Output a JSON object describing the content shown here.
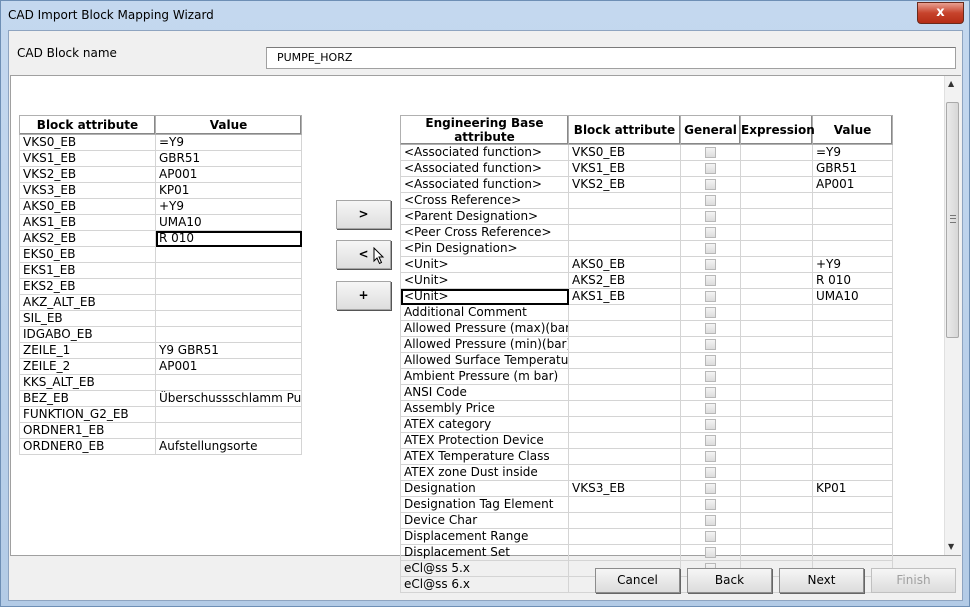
{
  "window": {
    "title": "CAD Import Block Mapping Wizard",
    "close": "x"
  },
  "block_name": {
    "label": "CAD Block name",
    "value": "PUMPE_HORZ"
  },
  "left_table": {
    "headers": [
      "Block attribute",
      "Value"
    ],
    "rows": [
      [
        "VKS0_EB",
        "=Y9"
      ],
      [
        "VKS1_EB",
        "GBR51"
      ],
      [
        "VKS2_EB",
        "AP001"
      ],
      [
        "VKS3_EB",
        "KP01"
      ],
      [
        "AKS0_EB",
        "+Y9"
      ],
      [
        "AKS1_EB",
        "UMA10"
      ],
      [
        "AKS2_EB",
        "R 010"
      ],
      [
        "EKS0_EB",
        ""
      ],
      [
        "EKS1_EB",
        ""
      ],
      [
        "EKS2_EB",
        ""
      ],
      [
        "AKZ_ALT_EB",
        ""
      ],
      [
        "SIL_EB",
        ""
      ],
      [
        "IDGABO_EB",
        ""
      ],
      [
        "ZEILE_1",
        "Y9 GBR51"
      ],
      [
        "ZEILE_2",
        "AP001"
      ],
      [
        "KKS_ALT_EB",
        ""
      ],
      [
        "BEZ_EB",
        "Überschussschlamm Pu"
      ],
      [
        "FUNKTION_G2_EB",
        ""
      ],
      [
        "ORDNER1_EB",
        ""
      ],
      [
        "ORDNER0_EB",
        "Aufstellungsorte"
      ]
    ]
  },
  "middle_buttons": {
    "assign": ">",
    "remove": "<",
    "add": "+"
  },
  "right_table": {
    "headers": [
      "Engineering Base attribute",
      "Block attribute",
      "General",
      "Expression",
      "Value"
    ],
    "rows": [
      [
        "<Associated function>",
        "VKS0_EB",
        "=Y9"
      ],
      [
        "<Associated function>",
        "VKS1_EB",
        "GBR51"
      ],
      [
        "<Associated function>",
        "VKS2_EB",
        "AP001"
      ],
      [
        "<Cross Reference>",
        "",
        ""
      ],
      [
        "<Parent Designation>",
        "",
        ""
      ],
      [
        "<Peer Cross Reference>",
        "",
        ""
      ],
      [
        "<Pin Designation>",
        "",
        ""
      ],
      [
        "<Unit>",
        "AKS0_EB",
        "+Y9"
      ],
      [
        "<Unit>",
        "AKS2_EB",
        "R 010"
      ],
      [
        "<Unit>",
        "AKS1_EB",
        "UMA10"
      ],
      [
        "Additional Comment",
        "",
        ""
      ],
      [
        "Allowed Pressure (max)(bar)",
        "",
        ""
      ],
      [
        "Allowed Pressure (min)(bar)",
        "",
        ""
      ],
      [
        "Allowed Surface Temperature (",
        "",
        ""
      ],
      [
        "Ambient Pressure (m bar)",
        "",
        ""
      ],
      [
        "ANSI Code",
        "",
        ""
      ],
      [
        "Assembly Price",
        "",
        ""
      ],
      [
        "ATEX category",
        "",
        ""
      ],
      [
        "ATEX Protection Device",
        "",
        ""
      ],
      [
        "ATEX Temperature Class",
        "",
        ""
      ],
      [
        "ATEX zone Dust inside",
        "",
        ""
      ],
      [
        "Designation",
        "VKS3_EB",
        "KP01"
      ],
      [
        "Designation Tag Element",
        "",
        ""
      ],
      [
        "Device Char",
        "",
        ""
      ],
      [
        "Displacement Range",
        "",
        ""
      ],
      [
        "Displacement Set",
        "",
        ""
      ],
      [
        "eCl@ss 5.x",
        "",
        ""
      ],
      [
        "eCl@ss 6.x",
        "",
        ""
      ]
    ]
  },
  "footer": {
    "cancel": "Cancel",
    "back": "Back",
    "next": "Next",
    "finish": "Finish"
  }
}
